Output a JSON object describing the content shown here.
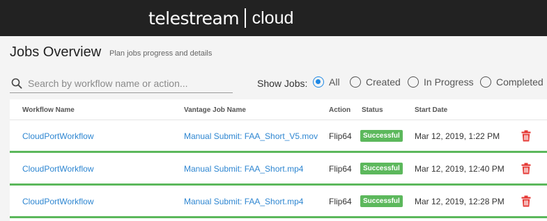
{
  "brand": {
    "logo_word": "telestream",
    "logo_cloud": "cloud"
  },
  "page": {
    "title": "Jobs Overview",
    "subtitle": "Plan jobs progress and details"
  },
  "search": {
    "placeholder": "Search by workflow name or action...",
    "value": ""
  },
  "filter": {
    "label": "Show Jobs:",
    "options": [
      {
        "label": "All",
        "checked": true
      },
      {
        "label": "Created",
        "checked": false
      },
      {
        "label": "In Progress",
        "checked": false
      },
      {
        "label": "Completed",
        "checked": false
      }
    ]
  },
  "table": {
    "columns": [
      "Workflow Name",
      "Vantage Job Name",
      "Action",
      "Status",
      "Start Date"
    ],
    "rows": [
      {
        "workflow": "CloudPortWorkflow",
        "job": "Manual Submit: FAA_Short_V5.mov",
        "action": "Flip64",
        "status": "Successful",
        "start": "Mar 12, 2019, 1:22 PM"
      },
      {
        "workflow": "CloudPortWorkflow",
        "job": "Manual Submit: FAA_Short.mp4",
        "action": "Flip64",
        "status": "Successful",
        "start": "Mar 12, 2019, 12:40 PM"
      },
      {
        "workflow": "CloudPortWorkflow",
        "job": "Manual Submit: FAA_Short.mp4",
        "action": "Flip64",
        "status": "Successful",
        "start": "Mar 12, 2019, 12:28 PM"
      }
    ]
  },
  "icons": {
    "search": "search-icon",
    "delete": "trash-icon"
  },
  "colors": {
    "topbar": "#222222",
    "link": "#2e86d1",
    "success": "#5cb85c",
    "delete": "#e53935",
    "radio_active": "#1e88e5"
  }
}
